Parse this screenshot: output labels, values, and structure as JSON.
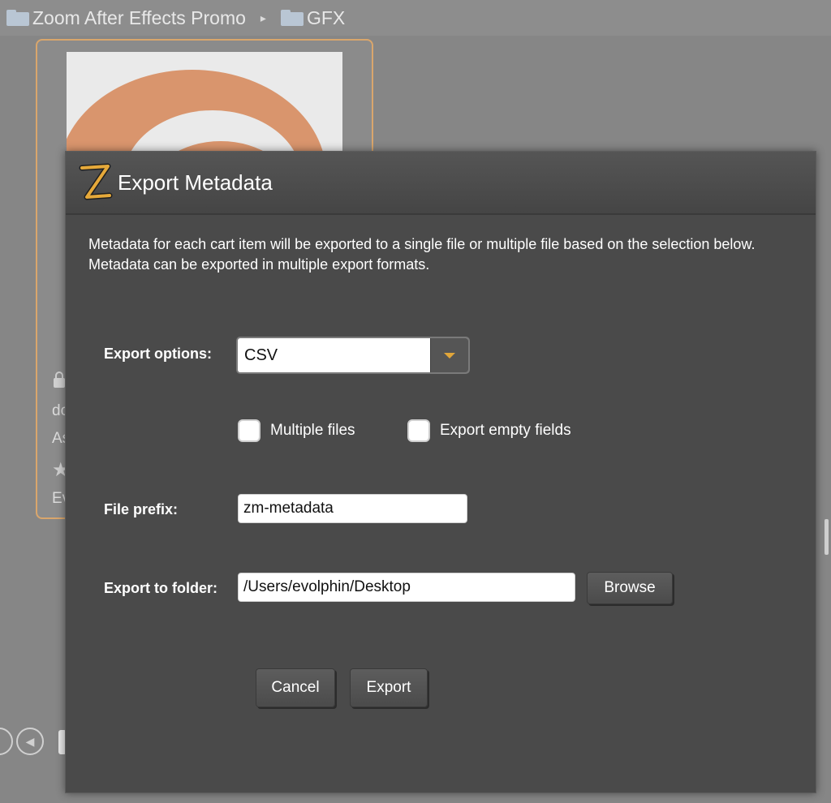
{
  "breadcrumb": {
    "items": [
      {
        "label": "Zoom After Effects Promo",
        "icon": "folder-icon"
      },
      {
        "label": "GFX",
        "icon": "folder-icon"
      }
    ],
    "separator": "▸"
  },
  "background": {
    "card_meta": [
      "dc",
      "As",
      "Ev"
    ]
  },
  "dialog": {
    "title": "Export Metadata",
    "logo_letter": "Z",
    "description": "Metadata for each cart item will be exported to a single file or multiple file based on the selection below. Metadata can be exported in multiple export formats.",
    "export_options": {
      "label": "Export options:",
      "selected": "CSV"
    },
    "multiple_files": {
      "label": "Multiple files",
      "checked": false
    },
    "export_empty_fields": {
      "label": "Export empty fields",
      "checked": false
    },
    "file_prefix": {
      "label": "File prefix:",
      "value": "zm-metadata"
    },
    "export_folder": {
      "label": "Export to folder:",
      "value": "/Users/evolphin/Desktop",
      "browse_label": "Browse"
    },
    "cancel_label": "Cancel",
    "export_label": "Export"
  },
  "colors": {
    "dialog_bg": "#4a4a4a",
    "accent": "#e1a63a",
    "card_border": "#d9a66c",
    "thumb_swirl": "#d9956d"
  }
}
